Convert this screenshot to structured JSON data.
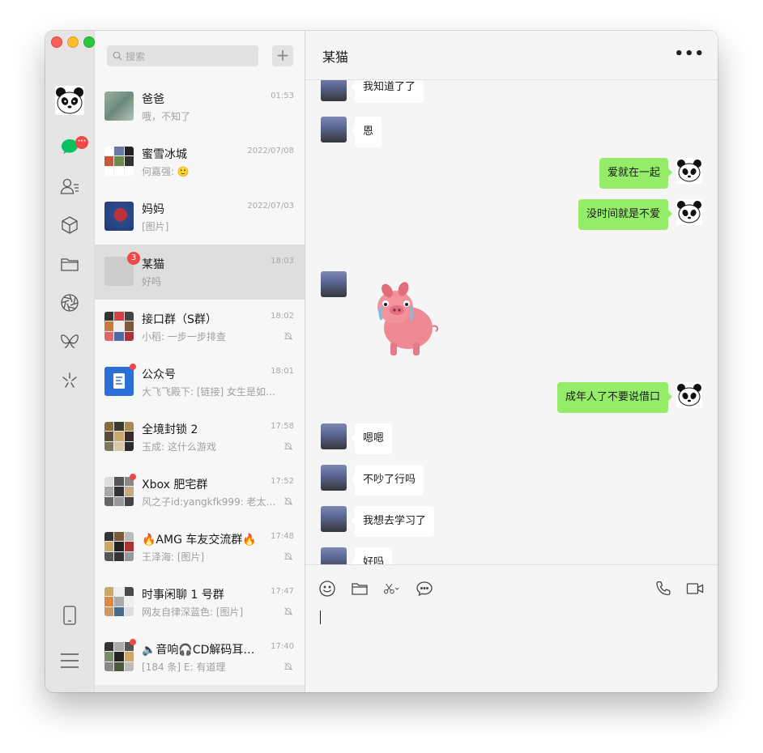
{
  "sidebar": {
    "chat_badge": "···",
    "icons": [
      "chat-icon",
      "contacts-icon",
      "favorites-cube-icon",
      "files-folder-icon",
      "moments-aperture-icon",
      "mini-programs-icon",
      "channels-icon",
      "phone-icon",
      "menu-icon"
    ]
  },
  "search": {
    "placeholder": "搜索",
    "add_label": "+"
  },
  "conversations": [
    {
      "name": "爸爸",
      "preview": "哦，不知了",
      "time": "01:53"
    },
    {
      "name": "蜜雪冰城",
      "preview": "何嘉强: 🙂",
      "time": "2022/07/08"
    },
    {
      "name": "妈妈",
      "preview": "[图片]",
      "time": "2022/07/03"
    },
    {
      "name": "某猫",
      "preview": "好吗",
      "time": "18:03",
      "unread": "3"
    },
    {
      "name": "接口群（S群）",
      "preview": "小稻: 一步一步排查",
      "time": "18:02"
    },
    {
      "name": "公众号",
      "preview": "大飞飞殿下: [链接] 女生是如何…",
      "time": "18:01"
    },
    {
      "name": "全境封锁 2",
      "preview": "玉成: 这什么游戏",
      "time": "17:58"
    },
    {
      "name": "Xbox 肥宅群",
      "preview": "风之子id:yangkfk999: 老太…",
      "time": "17:52"
    },
    {
      "name": "🔥AMG 车友交流群🔥",
      "preview": "王泽海: [图片]",
      "time": "17:48"
    },
    {
      "name": "时事闲聊 1 号群",
      "preview": "网友自律深蓝色: [图片]",
      "time": "17:47"
    },
    {
      "name": "🔈音响🎧CD解码耳…",
      "preview": "[184 条] E: 有道理",
      "time": "17:40"
    }
  ],
  "chat": {
    "title": "某猫",
    "more": "•••",
    "messages": [
      {
        "side": "in",
        "text": "我知道了了"
      },
      {
        "side": "in",
        "text": "恩"
      },
      {
        "side": "out",
        "text": "爱就在一起"
      },
      {
        "side": "out",
        "text": "没时间就是不爱"
      },
      {
        "side": "in",
        "text": "",
        "sticker": "crying-pig-sticker"
      },
      {
        "side": "out",
        "text": "成年人了不要说借口"
      },
      {
        "side": "in",
        "text": "嗯嗯"
      },
      {
        "side": "in",
        "text": "不吵了行吗"
      },
      {
        "side": "in",
        "text": "我想去学习了"
      },
      {
        "side": "in",
        "text": "好吗"
      }
    ]
  },
  "composer": {
    "tools": [
      "emoji-icon",
      "folder-icon",
      "scissors-icon",
      "chat-bubble-icon",
      "phone-call-icon",
      "video-call-icon"
    ]
  }
}
